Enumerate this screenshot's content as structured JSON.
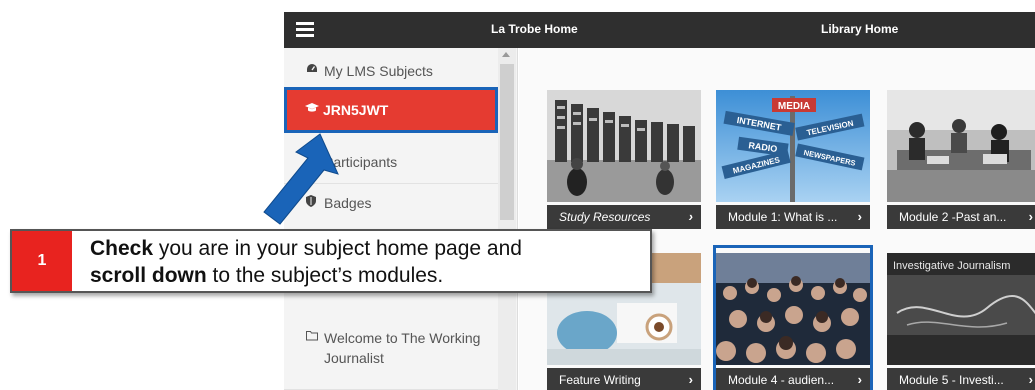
{
  "topbar": {
    "menu_icon": "hamburger-icon",
    "la_trobe_home": "La Trobe Home",
    "library_home": "Library Home"
  },
  "sidebar": {
    "items": [
      {
        "label": "My LMS Subjects",
        "icon": "dashboard-icon"
      },
      {
        "label": "JRN5JWT",
        "icon": "graduation-cap-icon",
        "active": true
      },
      {
        "label": "Participants",
        "icon": "users-icon"
      },
      {
        "label": "Badges",
        "icon": "shield-icon"
      },
      {
        "label": "Welcome to The Working Journalist",
        "icon": "folder-icon"
      }
    ]
  },
  "tiles": [
    {
      "caption": "Study Resources",
      "caption_italic": true
    },
    {
      "caption": "Module 1: What is ..."
    },
    {
      "caption": "Module 2 -Past an..."
    },
    {
      "caption": "Feature Writing"
    },
    {
      "caption": "Module 4 - audien..."
    },
    {
      "caption": "Module 5 - Investi..."
    }
  ],
  "images": {
    "media_signs": [
      "MEDIA",
      "INTERNET",
      "TELEVISION",
      "RADIO",
      "NEWSPAPERS",
      "MAGAZINES"
    ],
    "investigative": "Investigative Journalism"
  },
  "callout": {
    "step": "1",
    "bold1": "Check",
    "text1": " you are in your subject home page and",
    "bold2": "scroll down",
    "text2": " to the subject’s modules."
  },
  "colors": {
    "accent_red": "#e53b31",
    "accent_blue": "#1a64b8",
    "topbar": "#2f2f2f",
    "caption_bar": "#3a3a3a"
  }
}
